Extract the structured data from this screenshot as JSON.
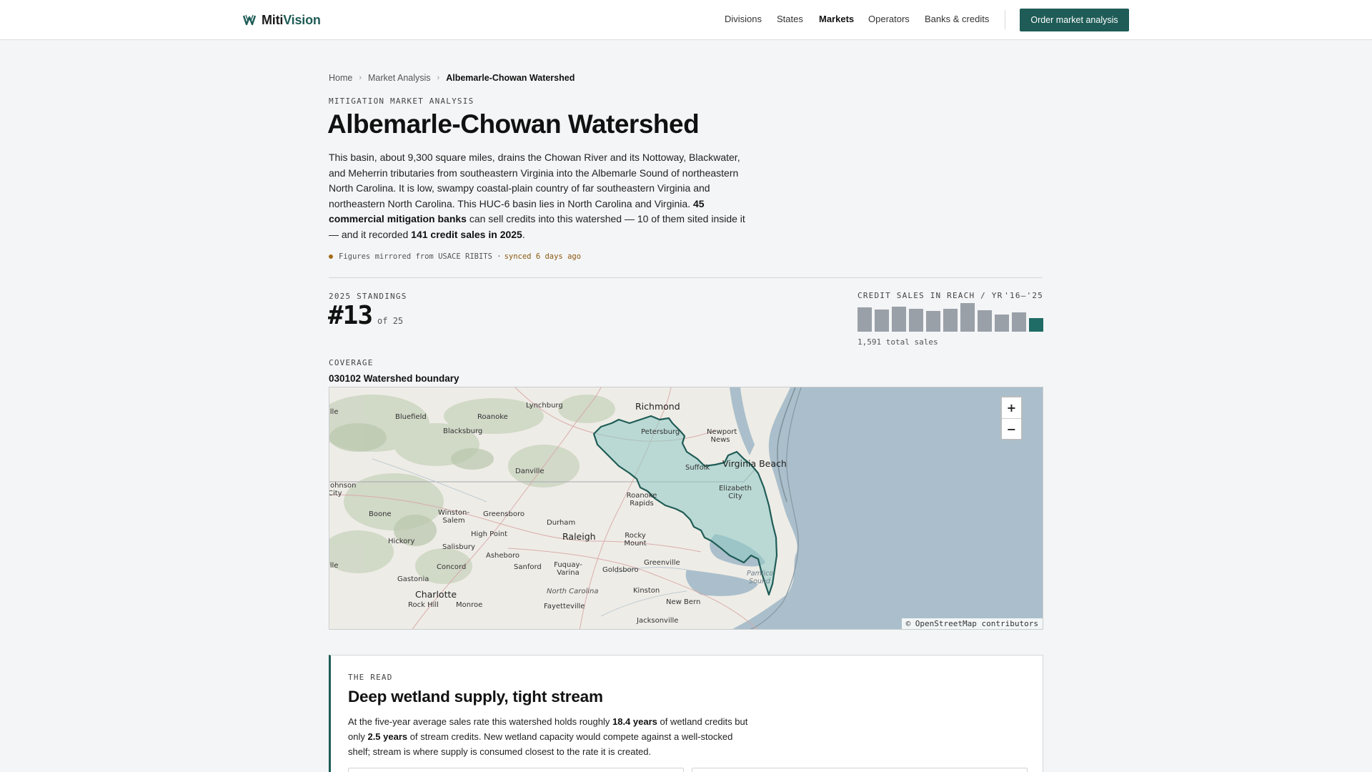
{
  "header": {
    "brand_part1": "Miti",
    "brand_part2": "Vision",
    "nav": [
      "Divisions",
      "States",
      "Markets",
      "Operators",
      "Banks & credits"
    ],
    "active_nav": "Markets",
    "cta_label": "Order market analysis",
    "accent_color": "#1f5c57"
  },
  "breadcrumb": [
    "Home",
    "Market Analysis",
    "Albemarle-Chowan Watershed"
  ],
  "kicker": "MITIGATION MARKET ANALYSIS",
  "title": "Albemarle-Chowan Watershed",
  "lede": {
    "p1": "This basin, about 9,300 square miles, drains the Chowan River and its Nottoway, Blackwater, and Meherrin tributaries from southeastern Virginia into the Albemarle Sound of northeastern North Carolina. It is low, swampy coastal-plain country of far southeastern Virginia and northeastern North Carolina. This HUC-6 basin lies in North Carolina and Virginia. ",
    "bold1": "45 commercial mitigation banks",
    "p2": " can sell credits into this watershed — 10 of them sited inside it — and it recorded ",
    "bold2": "141 credit sales in 2025",
    "p3": "."
  },
  "sync": {
    "text": "Figures mirrored from USACE RIBITS ·",
    "ago": "synced 6 days ago"
  },
  "standings": {
    "label": "2025 STANDINGS",
    "rank": "#13",
    "of": "of 25"
  },
  "sparkline": {
    "label": "CREDIT SALES IN REACH / YR",
    "range": "'16–'25",
    "total": "1,591 total sales",
    "values": [
      160,
      145,
      168,
      152,
      140,
      152,
      188,
      142,
      112,
      130,
      90
    ],
    "max": 190
  },
  "coverage": {
    "label": "COVERAGE",
    "name": "030102 Watershed boundary"
  },
  "map": {
    "zoom_in": "+",
    "zoom_out": "−",
    "attribution": "© OpenStreetMap contributors",
    "cities": [
      "Richmond",
      "Lynchburg",
      "Bluefield",
      "Roanoke",
      "Blacksburg",
      "Petersburg",
      "Newport News",
      "Virginia Beach",
      "Suffolk",
      "Danville",
      "Johnson City",
      "Elizabeth City",
      "Roanoke Rapids",
      "Boone",
      "Winston-Salem",
      "Greensboro",
      "Durham",
      "Raleigh",
      "High Point",
      "Rocky Mount",
      "Hickory",
      "Salisbury",
      "Asheboro",
      "Greenville",
      "Concord",
      "Sanford",
      "Fuquay-Varina",
      "Goldsboro",
      "Gastonia",
      "Charlotte",
      "North Carolina",
      "Pamlico Sound",
      "Kinston",
      "Rock Hill",
      "Monroe",
      "New Bern",
      "Fayetteville",
      "Jacksonville",
      "ille",
      "ille"
    ]
  },
  "read": {
    "label": "THE READ",
    "title": "Deep wetland supply, tight stream",
    "t1": "At the five-year average sales rate this watershed holds roughly ",
    "b1": "18.4 years",
    "t2": " of wetland credits but only ",
    "b2": "2.5 years",
    "t3": " of stream credits. New wetland capacity would compete against a well-stocked shelf; stream is where supply is consumed closest to the rate it is created."
  }
}
